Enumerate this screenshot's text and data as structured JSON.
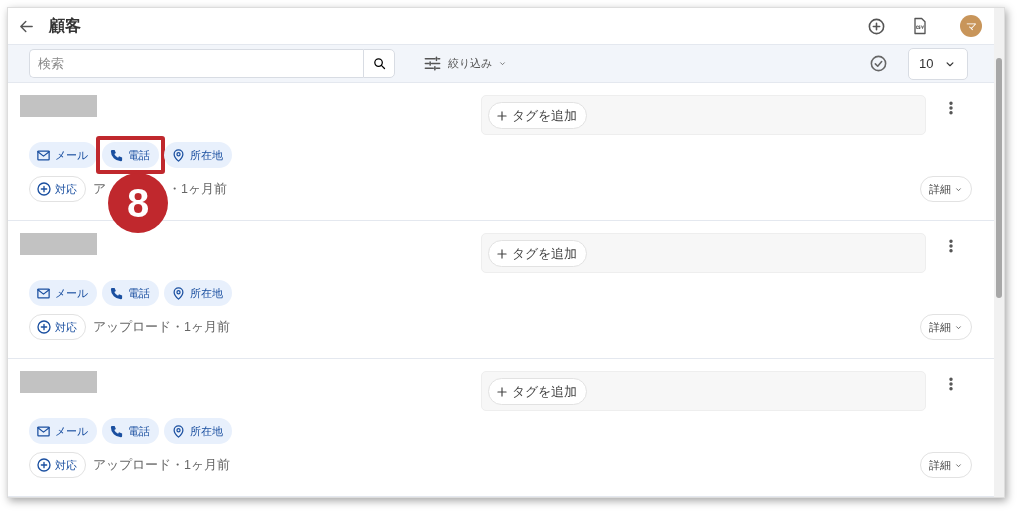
{
  "header": {
    "title": "顧客",
    "avatar": "マ"
  },
  "toolbar": {
    "search": {
      "placeholder": "検索"
    },
    "filter": "絞り込み",
    "page_size": "10"
  },
  "customers": [
    {
      "add_tag": "タグを追加",
      "contacts": [
        {
          "kind": "mail",
          "label": "メール",
          "highlighted": false
        },
        {
          "kind": "phone",
          "label": "電話",
          "highlighted": true
        },
        {
          "kind": "location",
          "label": "所在地",
          "highlighted": false
        }
      ],
      "respond": "対応",
      "upload": [
        "ア",
        "・1ヶ月前"
      ],
      "details": "詳細",
      "step_badge": "8"
    },
    {
      "add_tag": "タグを追加",
      "contacts": [
        {
          "kind": "mail",
          "label": "メール",
          "highlighted": false
        },
        {
          "kind": "phone",
          "label": "電話",
          "highlighted": false
        },
        {
          "kind": "location",
          "label": "所在地",
          "highlighted": false
        }
      ],
      "respond": "対応",
      "upload": [
        "アップロード・1ヶ月前"
      ],
      "details": "詳細"
    },
    {
      "add_tag": "タグを追加",
      "contacts": [
        {
          "kind": "mail",
          "label": "メール",
          "highlighted": false
        },
        {
          "kind": "phone",
          "label": "電話",
          "highlighted": false
        },
        {
          "kind": "location",
          "label": "所在地",
          "highlighted": false
        }
      ],
      "respond": "対応",
      "upload": [
        "アップロード・1ヶ月前"
      ],
      "details": "詳細"
    }
  ]
}
